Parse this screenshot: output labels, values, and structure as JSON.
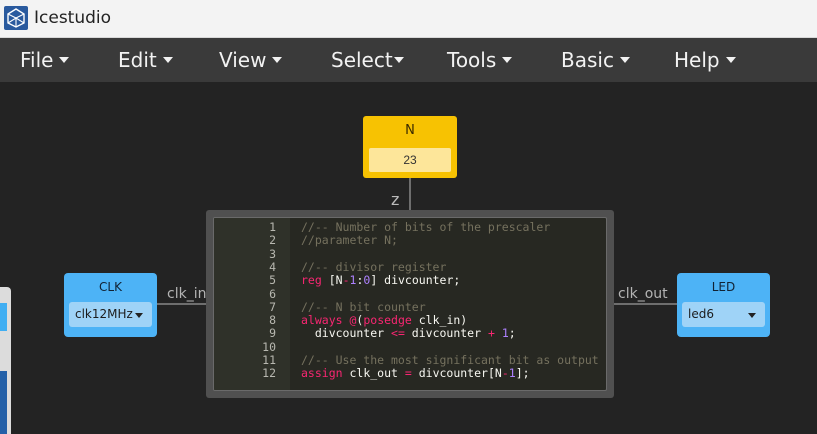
{
  "window": {
    "title": "Icestudio"
  },
  "menu": [
    {
      "label": "File"
    },
    {
      "label": "Edit"
    },
    {
      "label": "View"
    },
    {
      "label": "Select"
    },
    {
      "label": "Tools"
    },
    {
      "label": "Basic"
    },
    {
      "label": "Help"
    }
  ],
  "constant": {
    "name": "N",
    "value": "23",
    "port": "z"
  },
  "inputs": [
    {
      "name": "CLK",
      "value": "clk12MHz",
      "port": "clk_in"
    }
  ],
  "outputs": [
    {
      "name": "LED",
      "value": "led6",
      "port": "clk_out"
    }
  ],
  "code": {
    "line_numbers": [
      "1",
      "2",
      "3",
      "4",
      "5",
      "6",
      "7",
      "8",
      "9",
      "10",
      "11",
      "12"
    ],
    "lines": [
      "//-- Number of bits of the prescaler",
      "//parameter N;",
      "",
      "//-- divisor register",
      "reg [N-1:0] divcounter;",
      "",
      "//-- N bit counter",
      "always @(posedge clk_in)",
      "  divcounter <= divcounter + 1;",
      "",
      "//-- Use the most significant bit as output",
      "assign clk_out = divcounter[N-1];"
    ]
  },
  "colors": {
    "constant_block": "#f7c202",
    "io_block": "#4db3f6",
    "canvas": "#232323",
    "menubar": "#3a3a3a",
    "wire": "#6e6e6e"
  }
}
